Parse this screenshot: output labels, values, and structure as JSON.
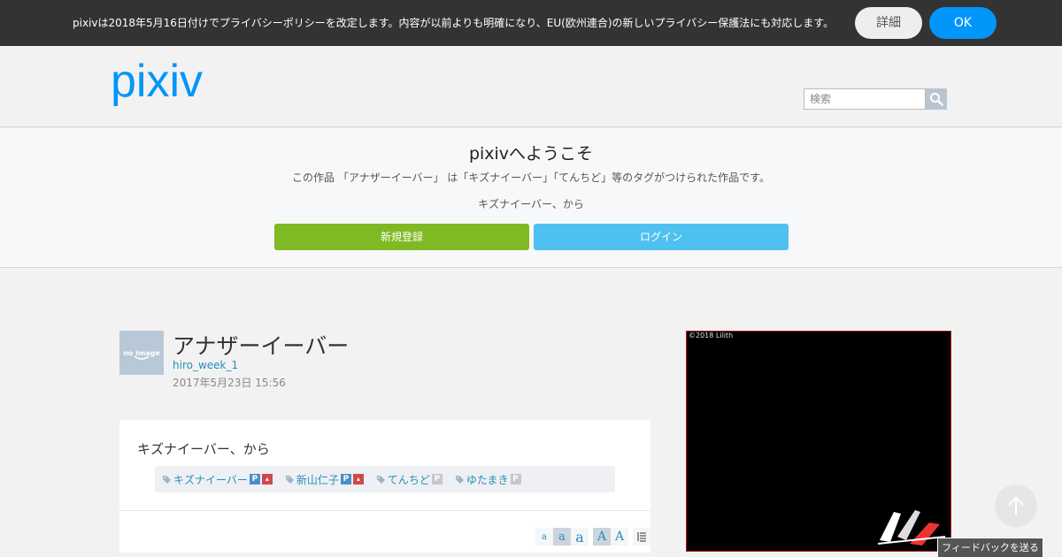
{
  "consent": {
    "text": "pixivは2018年5月16日付けでプライバシーポリシーを改定します。内容が以前よりも明確になり、EU(欧州連合)の新しいプライバシー保護法にも対応します。",
    "detail_label": "詳細",
    "ok_label": "OK"
  },
  "header": {
    "logo_text": "pixiv",
    "search_placeholder": "検索"
  },
  "welcome": {
    "title": "pixivへようこそ",
    "description": "この作品 「アナザーイーバー」 は「キズナイーバー」「てんちど」等のタグがつけられた作品です。",
    "caption": "キズナイーバー、から",
    "register_label": "新規登録",
    "login_label": "ログイン"
  },
  "work": {
    "avatar_text": "no image",
    "title": "アナザーイーバー",
    "author": "hiro_week_1",
    "date": "2017年5月23日 15:56",
    "caption": "キズナイーバー、から",
    "tags": [
      {
        "label": "キズナイーバー",
        "badges": [
          "P",
          "R"
        ]
      },
      {
        "label": "新山仁子",
        "badges": [
          "P",
          "R"
        ]
      },
      {
        "label": "てんちど",
        "badges": [
          "P-gray"
        ]
      },
      {
        "label": "ゆたまき",
        "badges": [
          "P-gray"
        ]
      }
    ],
    "font_sizes": [
      "a",
      "a",
      "a",
      "A",
      "A"
    ]
  },
  "artwork": {
    "copyright": "©2018 Lilith"
  },
  "feedback_label": "フィードバックを送る",
  "colors": {
    "accent": "#0096fa",
    "register": "#7fb924",
    "login": "#4fc1f0"
  }
}
